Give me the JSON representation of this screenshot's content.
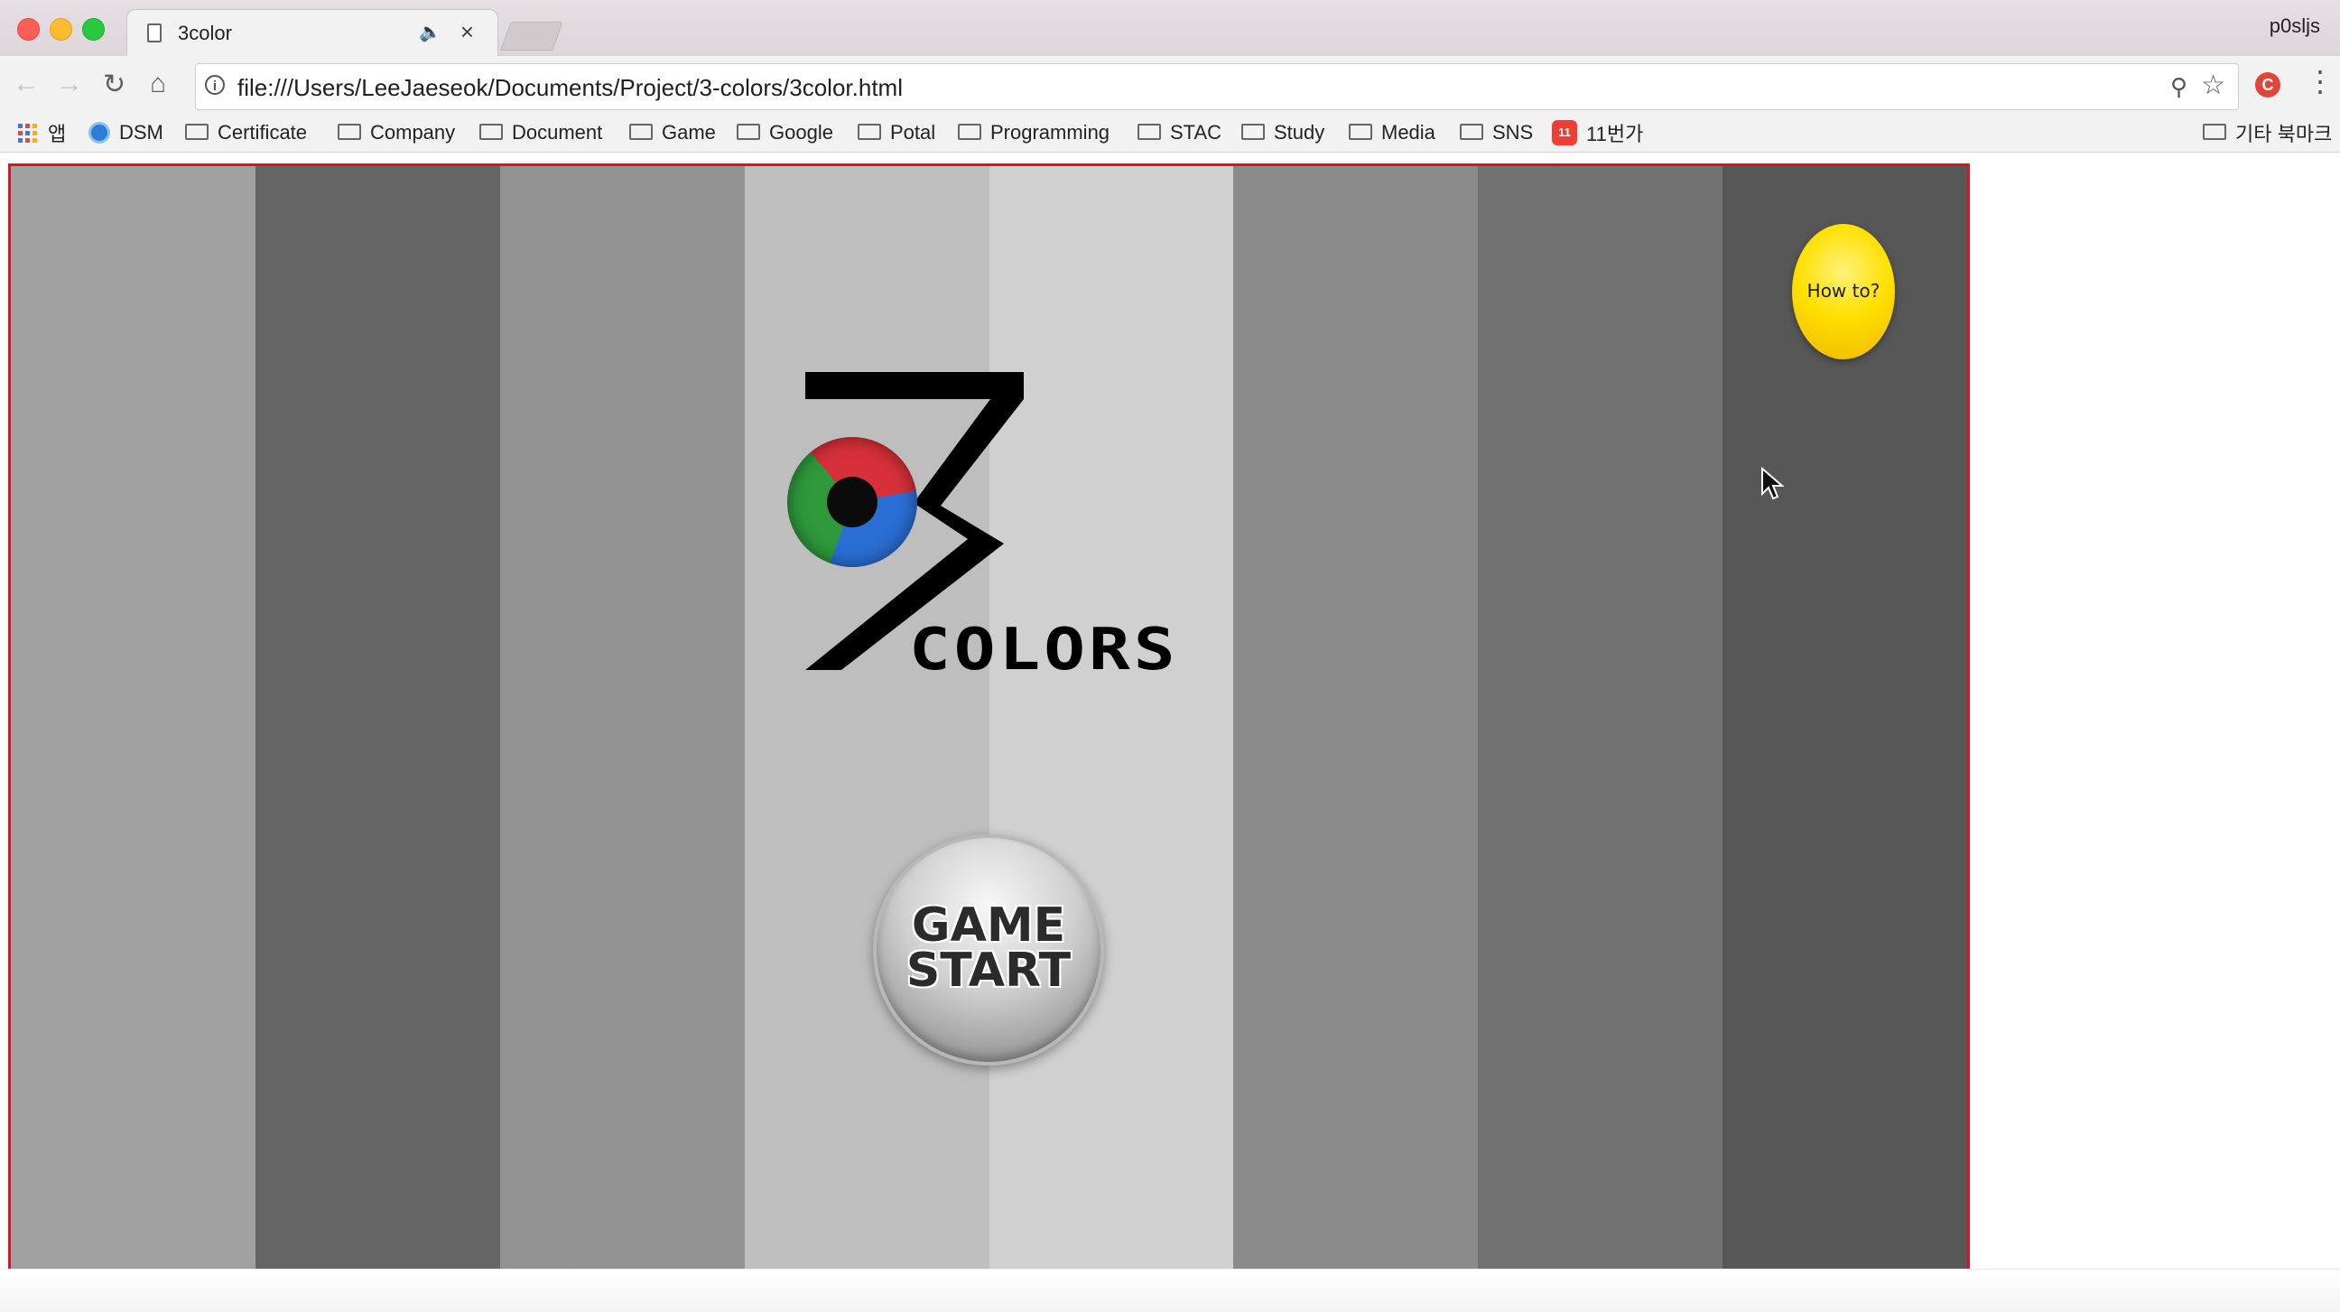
{
  "browser": {
    "tab": {
      "title": "3color",
      "audio_icon": "speaker-icon",
      "close_glyph": "×"
    },
    "profile_name": "p0sljs",
    "address_bar": {
      "url": "file:///Users/LeeJaeseok/Documents/Project/3-colors/3color.html"
    },
    "bookmarks": [
      {
        "label": "앱",
        "icon": "apps-icon"
      },
      {
        "label": "DSM",
        "icon": "dsm-icon"
      },
      {
        "label": "Certificate",
        "icon": "folder-icon"
      },
      {
        "label": "Company",
        "icon": "folder-icon"
      },
      {
        "label": "Document",
        "icon": "folder-icon"
      },
      {
        "label": "Game",
        "icon": "folder-icon"
      },
      {
        "label": "Google",
        "icon": "folder-icon"
      },
      {
        "label": "Potal",
        "icon": "folder-icon"
      },
      {
        "label": "Programming",
        "icon": "folder-icon"
      },
      {
        "label": "STAC",
        "icon": "folder-icon"
      },
      {
        "label": "Study",
        "icon": "folder-icon"
      },
      {
        "label": "Media",
        "icon": "folder-icon"
      },
      {
        "label": "SNS",
        "icon": "folder-icon"
      },
      {
        "label": "11번가",
        "icon": "11st-icon"
      }
    ],
    "other_bookmarks": "기타 북마크"
  },
  "game": {
    "border_color": "#e0121f",
    "stripe_colors": [
      "#a0a0a0",
      "#656565",
      "#939393",
      "#bebebe",
      "#d0d0d0",
      "#8b8b8b",
      "#727272",
      "#575757"
    ],
    "logo": {
      "numeral": "3",
      "word": "COLORS",
      "eye_colors": [
        "#d8303a",
        "#2a6fd6",
        "#2e9a3c"
      ]
    },
    "start_button": {
      "label": "GAME\nSTART"
    },
    "howto_button": {
      "label": "How to?"
    }
  }
}
